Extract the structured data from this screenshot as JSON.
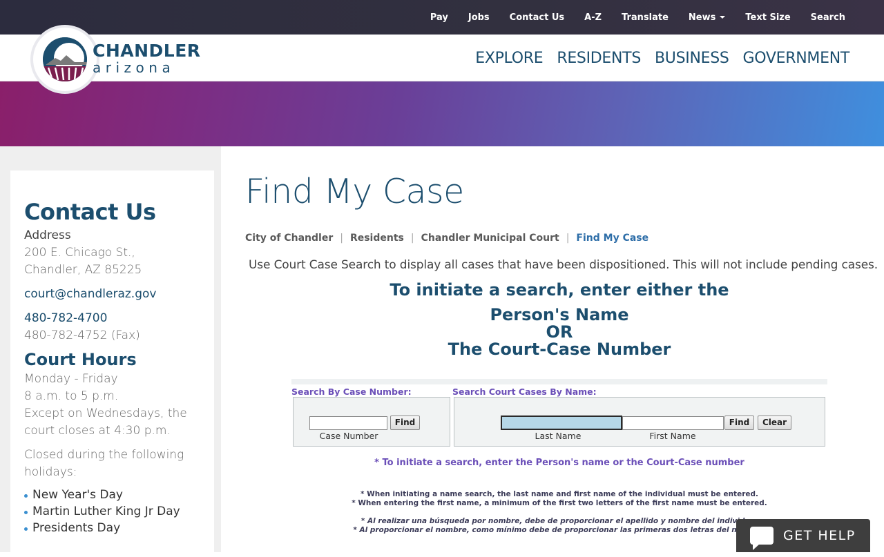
{
  "utility_nav": [
    "Pay",
    "Jobs",
    "Contact Us",
    "A-Z",
    "Translate",
    "News",
    "Text Size",
    "Search"
  ],
  "logo": {
    "line1": "CHANDLER",
    "line2": "arizona"
  },
  "main_nav": [
    "EXPLORE",
    "RESIDENTS",
    "BUSINESS",
    "GOVERNMENT"
  ],
  "sidebar": {
    "heading": "Contact Us",
    "address_label": "Address",
    "address_line1": "200 E. Chicago St.,",
    "address_line2": "Chandler, AZ 85225",
    "email": "court@chandleraz.gov",
    "phone": "480-782-4700",
    "fax": "480-782-4752 (Fax)",
    "hours_heading": "Court Hours",
    "hours_line1": "Monday - Friday",
    "hours_line2": "8 a.m. to 5 p.m.",
    "hours_line3": "Except on Wednesdays, the",
    "hours_line4": "court closes at 4:30 p.m.",
    "holidays_line1": "Closed during the following",
    "holidays_line2": "holidays:",
    "holidays": [
      "New Year's Day",
      "Martin Luther King Jr Day",
      "Presidents Day"
    ]
  },
  "page": {
    "title": "Find My Case",
    "breadcrumb": [
      "City of Chandler",
      "Residents",
      "Chandler Municipal Court",
      "Find My Case"
    ],
    "intro": "Use Court Case Search to display all cases that have been dispositioned. This will not include pending cases.",
    "headline1": "To initiate a search, enter either the",
    "headline2": "Person's Name",
    "headline3": "OR",
    "headline4": "The Court-Case Number"
  },
  "search": {
    "case_label": "Search By Case Number:",
    "name_label": "Search Court Cases By Name:",
    "case_number_value": "",
    "case_number_caption": "Case Number",
    "find_label": "Find",
    "last_name_value": "",
    "last_name_caption": "Last Name",
    "first_name_value": "",
    "first_name_caption": "First Name",
    "clear_label": "Clear"
  },
  "notes": {
    "primary": "* To initiate a search, enter the Person's name or the Court-Case number",
    "en1": "* When initiating a name search, the last name and first name of the individual must be entered.",
    "en2": "* When entering the first name, a minimum of the first two letters of the first name must be entered.",
    "es1": "* Al realizar una búsqueda por nombre, debe de proporcionar el apellido y nombre del individuo.",
    "es2": "* Al proporcionar el nombre, como mínimo debe de proporcionar las primeras dos letras del nombre."
  },
  "help": {
    "label": "GET HELP"
  },
  "colors": {
    "brand_navy": "#1c4e6e",
    "form_purple": "#6b4fb8",
    "focus_field": "#b6d8e8"
  }
}
